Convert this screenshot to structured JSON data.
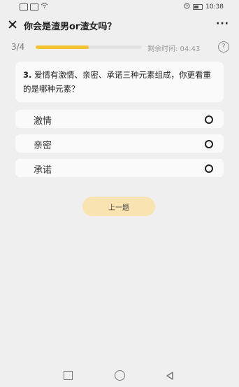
{
  "status_bar": {
    "time": "10:38"
  },
  "nav": {
    "title": "你会是渣男or渣女吗？",
    "more": "···"
  },
  "progress": {
    "label": "3/4",
    "fraction": 0.5,
    "accent_color": "#f4c430",
    "timer": "剩余时间: 04:43",
    "help": "?"
  },
  "question": {
    "number": "3.",
    "text": "爱情有激情、亲密、承诺三种元素组成，你更看重的是哪种元素？"
  },
  "options": [
    {
      "label": "激情"
    },
    {
      "label": "亲密"
    },
    {
      "label": "承诺"
    }
  ],
  "buttons": {
    "prev": "上一题"
  }
}
